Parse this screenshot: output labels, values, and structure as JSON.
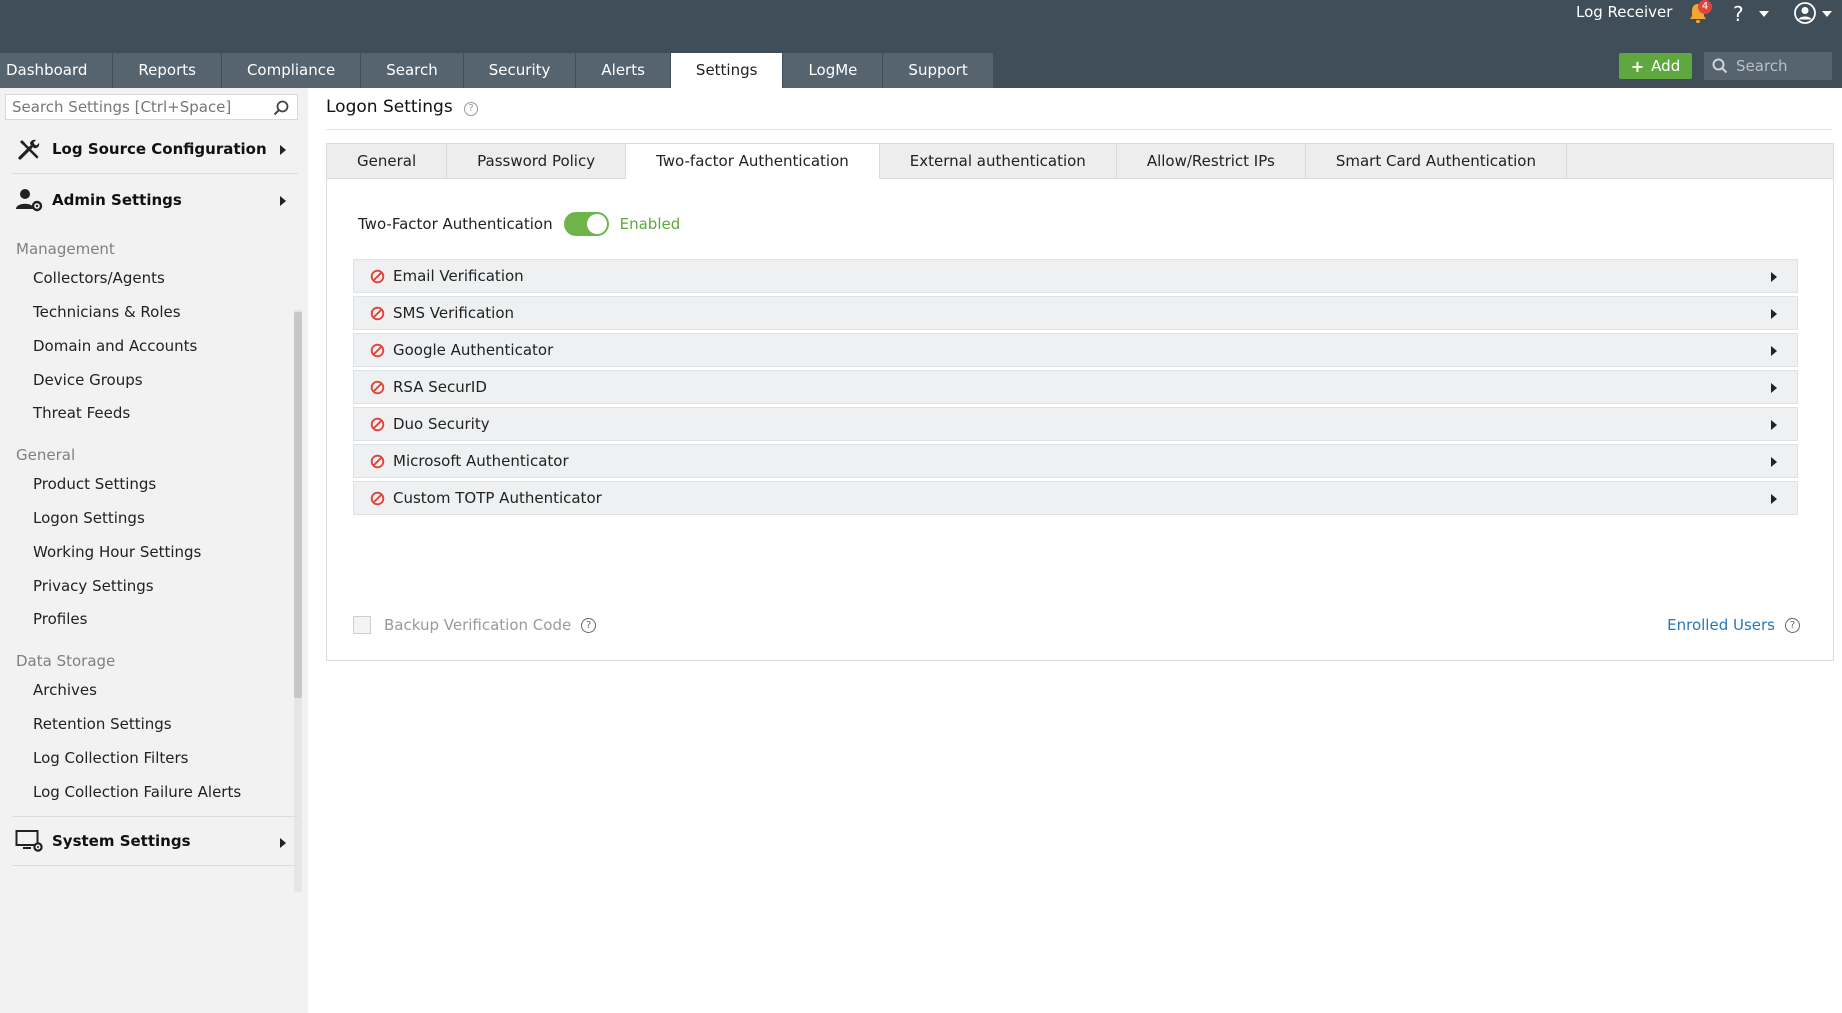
{
  "header": {
    "receiver": "Log Receiver",
    "notification_count": "4",
    "help": "?",
    "nav": [
      "Dashboard",
      "Reports",
      "Compliance",
      "Search",
      "Security",
      "Alerts",
      "Settings",
      "LogMe",
      "Support"
    ],
    "active_nav": "Settings",
    "add_label": "Add",
    "search_placeholder": "Search"
  },
  "sidebar": {
    "search_placeholder": "Search Settings [Ctrl+Space]",
    "sections": {
      "log_source": "Log Source Configuration",
      "admin": "Admin Settings",
      "system": "System Settings"
    },
    "groups": {
      "management": {
        "title": "Management",
        "items": [
          "Collectors/Agents",
          "Technicians & Roles",
          "Domain and Accounts",
          "Device Groups",
          "Threat Feeds"
        ]
      },
      "general": {
        "title": "General",
        "items": [
          "Product Settings",
          "Logon Settings",
          "Working Hour Settings",
          "Privacy Settings",
          "Profiles"
        ]
      },
      "storage": {
        "title": "Data Storage",
        "items": [
          "Archives",
          "Retention Settings",
          "Log Collection Filters",
          "Log Collection Failure Alerts"
        ]
      }
    }
  },
  "main": {
    "title": "Logon Settings",
    "tabs": [
      "General",
      "Password Policy",
      "Two-factor Authentication",
      "External authentication",
      "Allow/Restrict IPs",
      "Smart Card Authentication"
    ],
    "active_tab": "Two-factor Authentication",
    "tfa_label": "Two-Factor Authentication",
    "tfa_status": "Enabled",
    "methods": [
      "Email Verification",
      "SMS Verification",
      "Google Authenticator",
      "RSA SecurID",
      "Duo Security",
      "Microsoft Authenticator",
      "Custom TOTP Authenticator"
    ],
    "backup_label": "Backup Verification Code",
    "enrolled_label": "Enrolled Users"
  },
  "colors": {
    "header_bg": "#404e59",
    "tab_bg": "#56646f",
    "accent_green": "#5fa83f",
    "link_blue": "#2a77b8",
    "disabled_red": "#e0453b"
  }
}
